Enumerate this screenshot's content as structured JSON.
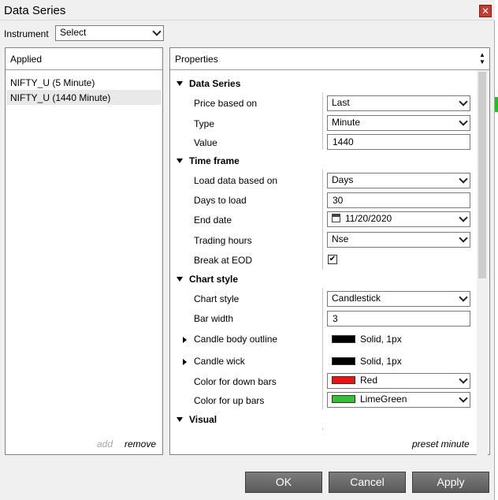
{
  "window": {
    "title": "Data Series",
    "close_glyph": "✕"
  },
  "instrument": {
    "label": "Instrument",
    "value": "Select"
  },
  "applied": {
    "header": "Applied",
    "items": [
      "NIFTY_U (5 Minute)",
      "NIFTY_U (1440 Minute)"
    ],
    "add_label": "add",
    "remove_label": "remove"
  },
  "properties": {
    "header": "Properties",
    "sections": {
      "data_series": {
        "title": "Data Series",
        "price_based_on": {
          "label": "Price based on",
          "value": "Last"
        },
        "type": {
          "label": "Type",
          "value": "Minute"
        },
        "value": {
          "label": "Value",
          "value": "1440"
        }
      },
      "time_frame": {
        "title": "Time frame",
        "load_data_based_on": {
          "label": "Load data based on",
          "value": "Days"
        },
        "days_to_load": {
          "label": "Days to load",
          "value": "30"
        },
        "end_date": {
          "label": "End date",
          "value": "11/20/2020"
        },
        "trading_hours": {
          "label": "Trading hours",
          "value": "Nse"
        },
        "break_at_eod": {
          "label": "Break at EOD",
          "checked": true,
          "check_glyph": "✔"
        }
      },
      "chart_style": {
        "title": "Chart style",
        "chart_style": {
          "label": "Chart style",
          "value": "Candlestick"
        },
        "bar_width": {
          "label": "Bar width",
          "value": "3"
        },
        "candle_body_outline": {
          "label": "Candle body outline",
          "value": "Solid, 1px",
          "color": "#000000"
        },
        "candle_wick": {
          "label": "Candle wick",
          "value": "Solid, 1px",
          "color": "#000000"
        },
        "color_down": {
          "label": "Color for down bars",
          "value": "Red",
          "color": "#ee1111"
        },
        "color_up": {
          "label": "Color for up bars",
          "value": "LimeGreen",
          "color": "#33c233"
        }
      },
      "visual": {
        "title": "Visual"
      }
    },
    "preset_label": "preset minute"
  },
  "buttons": {
    "ok": "OK",
    "cancel": "Cancel",
    "apply": "Apply"
  }
}
